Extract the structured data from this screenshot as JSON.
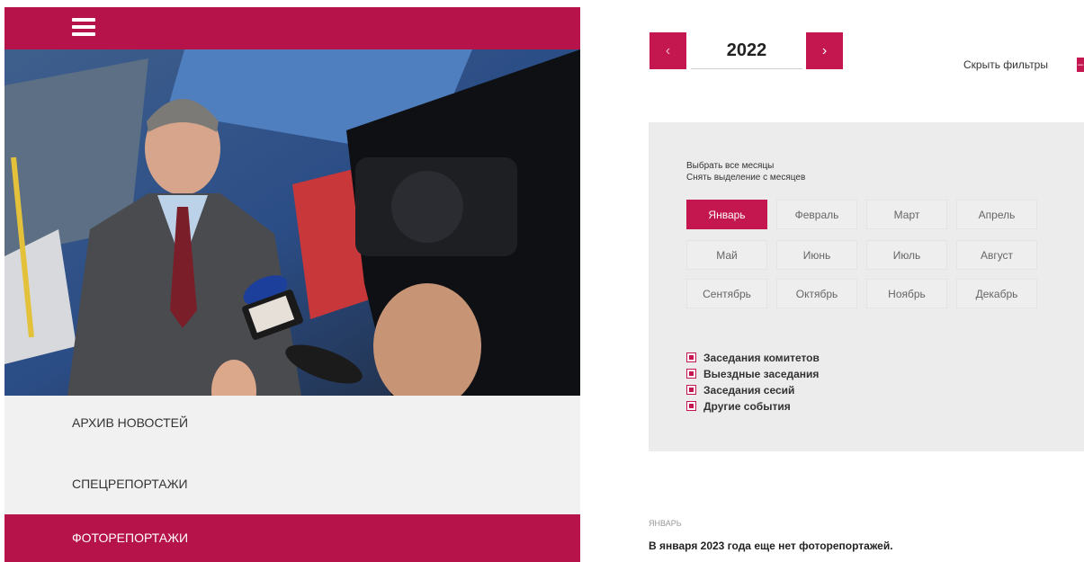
{
  "left_menu": {
    "items": [
      {
        "label": "АРХИВ НОВОСТЕЙ"
      },
      {
        "label": "СПЕЦРЕПОРТАЖИ"
      },
      {
        "label": "ФОТОРЕПОРТАЖИ",
        "active": true
      }
    ]
  },
  "year_nav": {
    "year": "2022",
    "prev_icon": "chevron-left-icon",
    "next_icon": "chevron-right-icon"
  },
  "filters": {
    "hide_label": "Скрыть фильтры",
    "select_all": "Выбрать все месяцы",
    "deselect_all": "Снять выделение с месяцев",
    "months": [
      "Январь",
      "Февраль",
      "Март",
      "Апрель",
      "Май",
      "Июнь",
      "Июль",
      "Август",
      "Сентябрь",
      "Октябрь",
      "Ноябрь",
      "Декабрь"
    ],
    "active_month": "Январь",
    "event_types": [
      {
        "label": "Заседания комитетов",
        "checked": true
      },
      {
        "label": "Выездные заседания",
        "checked": true
      },
      {
        "label": "Заседания сесий",
        "checked": true
      },
      {
        "label": "Другие события",
        "checked": true
      }
    ]
  },
  "results": {
    "month_heading": "ЯНВАРЬ",
    "empty_message": "В января 2023 года еще нет фоторепортажей."
  },
  "colors": {
    "accent": "#c4164f",
    "panel_bg": "#ececec"
  }
}
